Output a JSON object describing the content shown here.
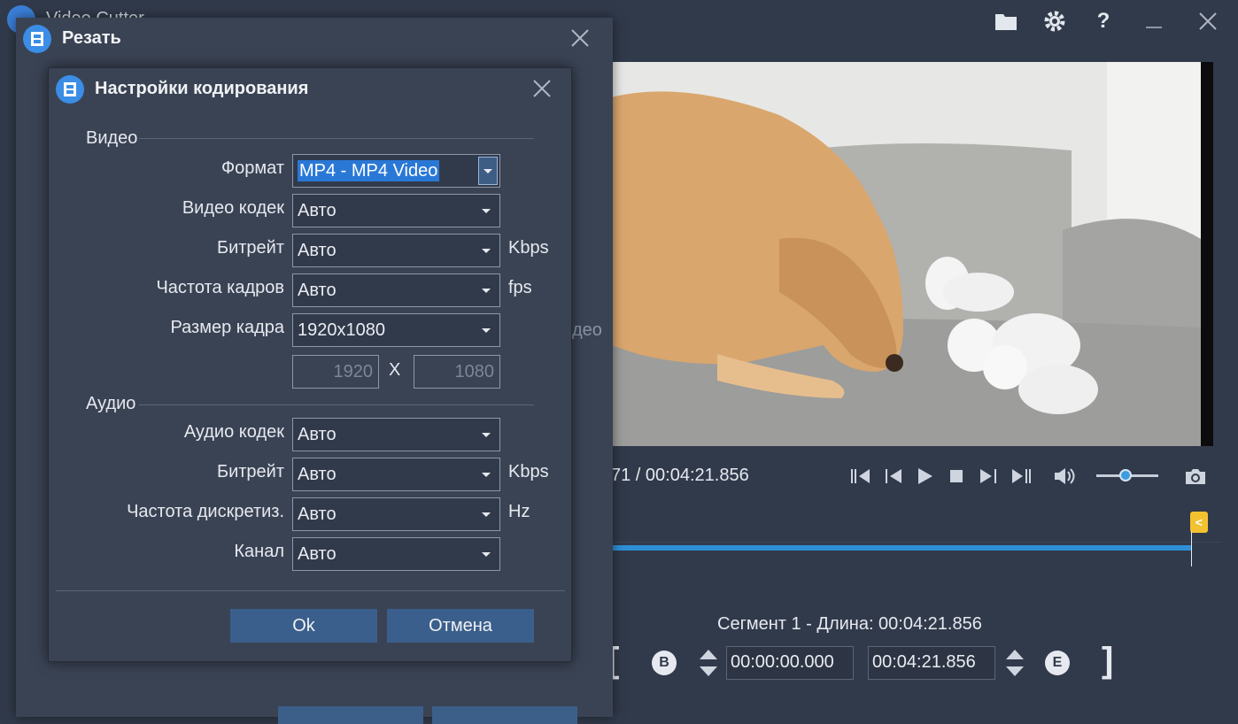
{
  "app": {
    "title": "Video Cutter",
    "time_readout": "71 / 00:04:21.856",
    "segment_label": "Сегмент 1 - Длина: 00:04:21.856",
    "start_time": "00:00:00.000",
    "end_time": "00:04:21.856",
    "begin_button": "B",
    "end_button": "E",
    "end_marker": "<",
    "ghost_video_text": "део"
  },
  "cut_dialog": {
    "title": "Резать"
  },
  "encoding_dialog": {
    "title": "Настройки кодирования",
    "video_group": "Видео",
    "audio_group": "Аудио",
    "video": {
      "format_label": "Формат",
      "format_value": "MP4 - MP4 Video",
      "codec_label": "Видео кодек",
      "codec_value": "Авто",
      "bitrate_label": "Битрейт",
      "bitrate_value": "Авто",
      "bitrate_unit": "Kbps",
      "framerate_label": "Частота кадров",
      "framerate_value": "Авто",
      "framerate_unit": "fps",
      "size_label": "Размер кадра",
      "size_value": "1920x1080",
      "width_value": "1920",
      "height_value": "1080",
      "size_separator": "X"
    },
    "audio": {
      "codec_label": "Аудио кодек",
      "codec_value": "Авто",
      "bitrate_label": "Битрейт",
      "bitrate_value": "Авто",
      "bitrate_unit": "Kbps",
      "samplerate_label": "Частота дискретиз.",
      "samplerate_value": "Авто",
      "samplerate_unit": "Hz",
      "channel_label": "Канал",
      "channel_value": "Авто"
    },
    "ok_label": "Ok",
    "cancel_label": "Отмена"
  },
  "colors": {
    "background": "#313a4b",
    "dialog": "#3a4354",
    "accent": "#2a78d6",
    "marker": "#f2c230"
  },
  "icons": {
    "folder": "folder-icon",
    "settings": "gear-icon",
    "help": "help-icon",
    "minimize": "minimize-icon",
    "close": "close-icon",
    "camera": "camera-icon",
    "volume": "volume-icon"
  }
}
